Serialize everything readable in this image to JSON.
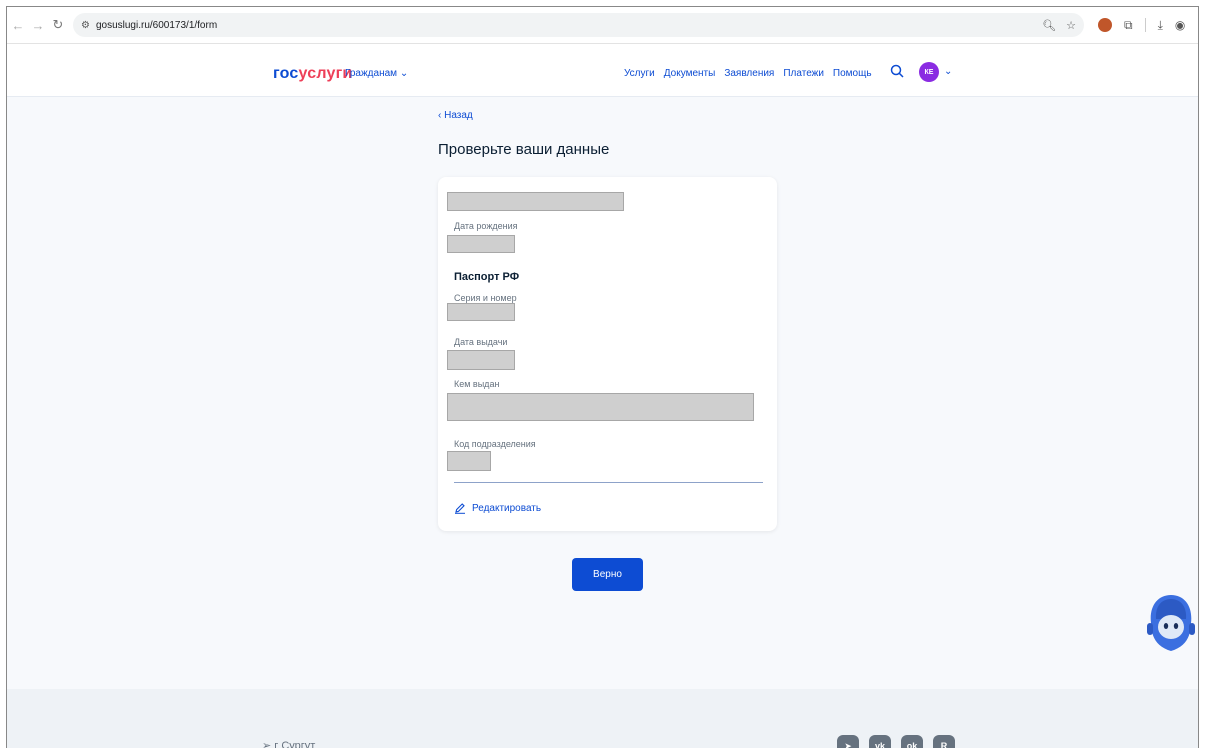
{
  "browser": {
    "url": "gosuslugi.ru/600173/1/form"
  },
  "header": {
    "logo_gos": "гос",
    "logo_uslugi": "услуги",
    "audience": "Гражданам",
    "nav": [
      "Услуги",
      "Документы",
      "Заявления",
      "Платежи",
      "Помощь"
    ],
    "user_initials": "КЕ"
  },
  "main": {
    "back": "Назад",
    "title": "Проверьте ваши данные",
    "card": {
      "birth_label": "Дата рождения",
      "passport_title": "Паспорт РФ",
      "series_label": "Серия и номер",
      "issue_date_label": "Дата выдачи",
      "issued_by_label": "Кем выдан",
      "dept_code_label": "Код подразделения",
      "edit_label": "Редактировать"
    },
    "confirm_button": "Верно"
  },
  "footer": {
    "city": "г Сургут",
    "socials": [
      "telegram-icon",
      "vk-icon",
      "ok-icon",
      "rutube-icon"
    ]
  },
  "colors": {
    "brand_blue": "#0d4cd3",
    "brand_red": "#ee3f58",
    "avatar": "#8a2be2"
  }
}
